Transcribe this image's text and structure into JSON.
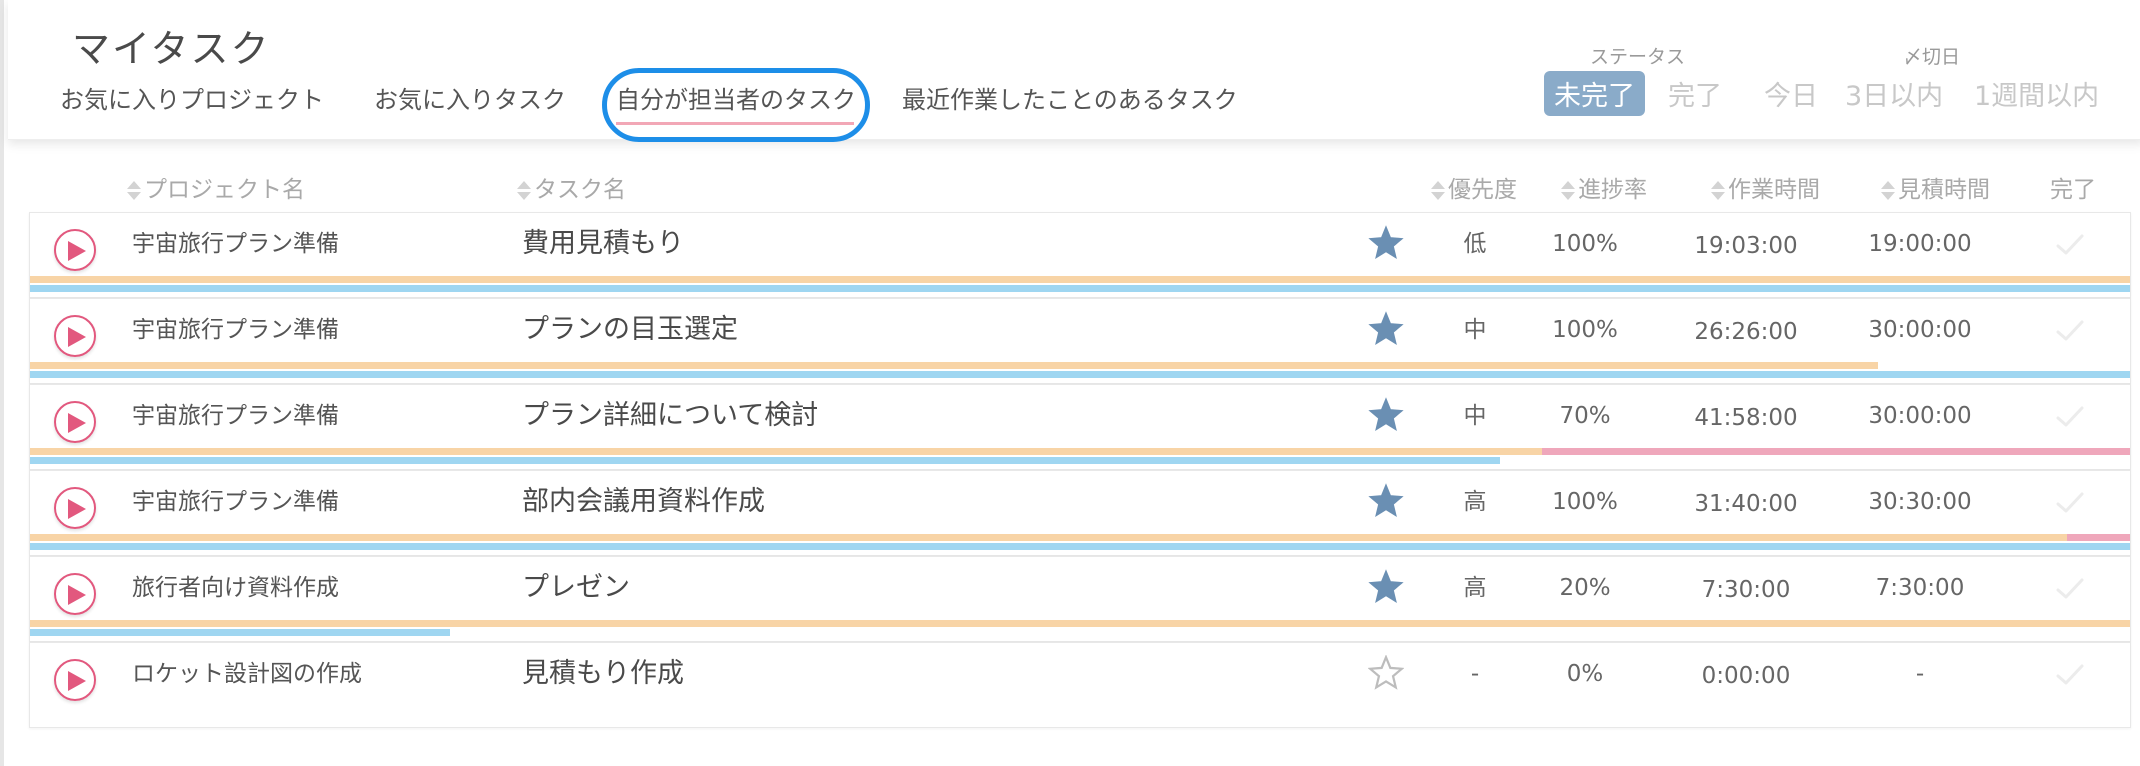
{
  "header": {
    "title": "マイタスク",
    "tabs": [
      {
        "label": "お気に入りプロジェクト"
      },
      {
        "label": "お気に入りタスク"
      },
      {
        "label": "自分が担当者のタスク"
      },
      {
        "label": "最近作業したことのあるタスク"
      }
    ],
    "active_tab": 2,
    "status_filter": {
      "label": "ステータス",
      "options": [
        "未完了",
        "完了"
      ],
      "selected": "未完了"
    },
    "due_filter": {
      "label": "〆切日",
      "options": [
        "今日",
        "3日以内",
        "1週間以内"
      ]
    }
  },
  "table": {
    "columns": {
      "project": "プロジェクト名",
      "task": "タスク名",
      "priority": "優先度",
      "progress": "進捗率",
      "work_time": "作業時間",
      "estimate": "見積時間",
      "done": "完了"
    },
    "rows": [
      {
        "project": "宇宙旅行プラン準備",
        "task": "費用見積もり",
        "favorite": true,
        "priority": "低",
        "progress": "100%",
        "work_time": "19:03:00",
        "estimate": "19:00:00",
        "bar_orange": 1.0,
        "bar_pink": 0,
        "bar_blue": 1.0
      },
      {
        "project": "宇宙旅行プラン準備",
        "task": "プランの目玉選定",
        "favorite": true,
        "priority": "中",
        "progress": "100%",
        "work_time": "26:26:00",
        "estimate": "30:00:00",
        "bar_orange": 0.88,
        "bar_pink": 0,
        "bar_blue": 1.0
      },
      {
        "project": "宇宙旅行プラン準備",
        "task": "プラン詳細について検討",
        "favorite": true,
        "priority": "中",
        "progress": "70%",
        "work_time": "41:58:00",
        "estimate": "30:00:00",
        "bar_orange": 0.72,
        "bar_pink": 0.28,
        "bar_blue": 0.7
      },
      {
        "project": "宇宙旅行プラン準備",
        "task": "部内会議用資料作成",
        "favorite": true,
        "priority": "高",
        "progress": "100%",
        "work_time": "31:40:00",
        "estimate": "30:30:00",
        "bar_orange": 0.97,
        "bar_pink": 0.03,
        "bar_blue": 1.0
      },
      {
        "project": "旅行者向け資料作成",
        "task": "プレゼン",
        "favorite": true,
        "priority": "高",
        "progress": "20%",
        "work_time": "7:30:00",
        "estimate": "7:30:00",
        "bar_orange": 1.0,
        "bar_pink": 0,
        "bar_blue": 0.2
      },
      {
        "project": "ロケット設計図の作成",
        "task": "見積もり作成",
        "favorite": false,
        "priority": "-",
        "progress": "0%",
        "work_time": "0:00:00",
        "estimate": "-",
        "bar_orange": 0,
        "bar_pink": 0,
        "bar_blue": 0
      }
    ]
  },
  "colors": {
    "accent_pink": "#e2587e",
    "star_filled": "#6a8fb3",
    "status_selected_bg": "#8aabc9",
    "bar_work": "#f8d4a6",
    "bar_over": "#efa7bb",
    "bar_progress": "#9fd6f1",
    "focus_ring": "#1d8ee8"
  },
  "icons": [
    "play-icon",
    "star-icon",
    "check-icon",
    "sort-icon"
  ]
}
